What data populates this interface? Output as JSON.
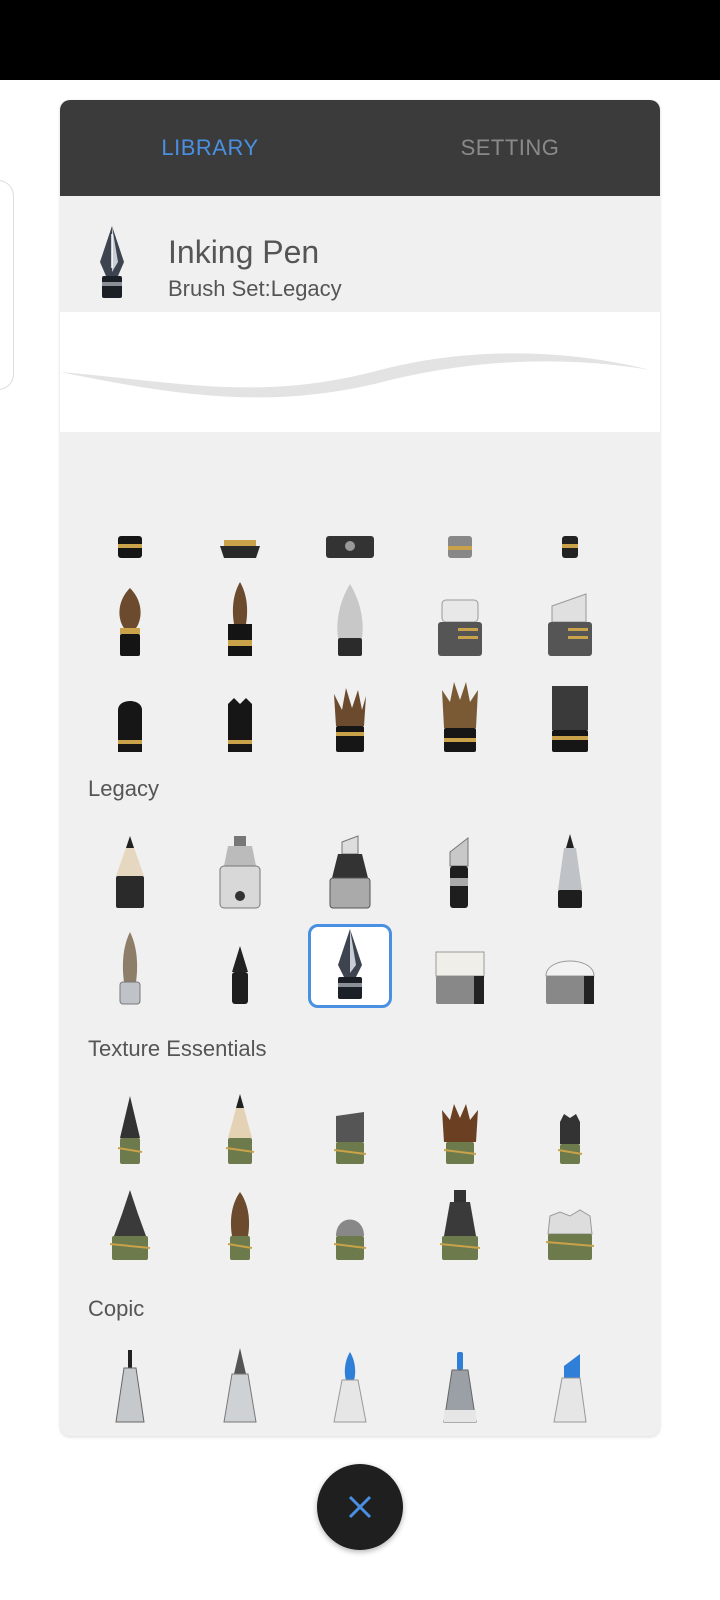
{
  "tabs": {
    "library": "LIBRARY",
    "setting": "SETTING"
  },
  "current_brush": {
    "name": "Inking Pen",
    "set": "Brush Set:Legacy"
  },
  "sections": {
    "legacy": "Legacy",
    "texture": "Texture Essentials",
    "copic": "Copic"
  },
  "close_icon": "close-icon",
  "accent": "#4a90e2"
}
